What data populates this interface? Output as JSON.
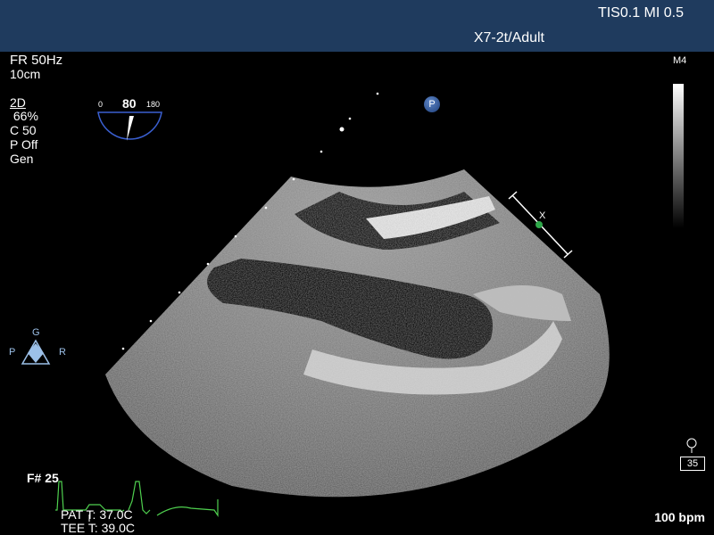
{
  "header": {
    "indices": "TIS0.1   MI 0.5",
    "transducer": "X7-2t/Adult"
  },
  "left_panel": {
    "frame_rate": "FR 50Hz",
    "depth": "10cm",
    "mode": "2D",
    "gain": " 66%",
    "compression": "C 50",
    "power": "P Off",
    "preset": "Gen"
  },
  "probe_angle": {
    "min": "0",
    "value": "80",
    "max": "180"
  },
  "grayscale_label": "M4",
  "position_badge": "P",
  "focus_marker": "X",
  "orientation": {
    "top": "G",
    "left": "P",
    "right": "R"
  },
  "footer": {
    "frame_number": "F# 25",
    "patient_temp": "PAT T: 37.0C",
    "tee_temp": "TEE T: 39.0C",
    "heart_rate": "100 bpm",
    "resp_box": "35"
  },
  "colors": {
    "header_bg": "#1f3b5e",
    "ecg_trace": "#4fd04f",
    "angle_indicator": "#3a5fd0",
    "orientation_marker": "#9cc0e8"
  }
}
